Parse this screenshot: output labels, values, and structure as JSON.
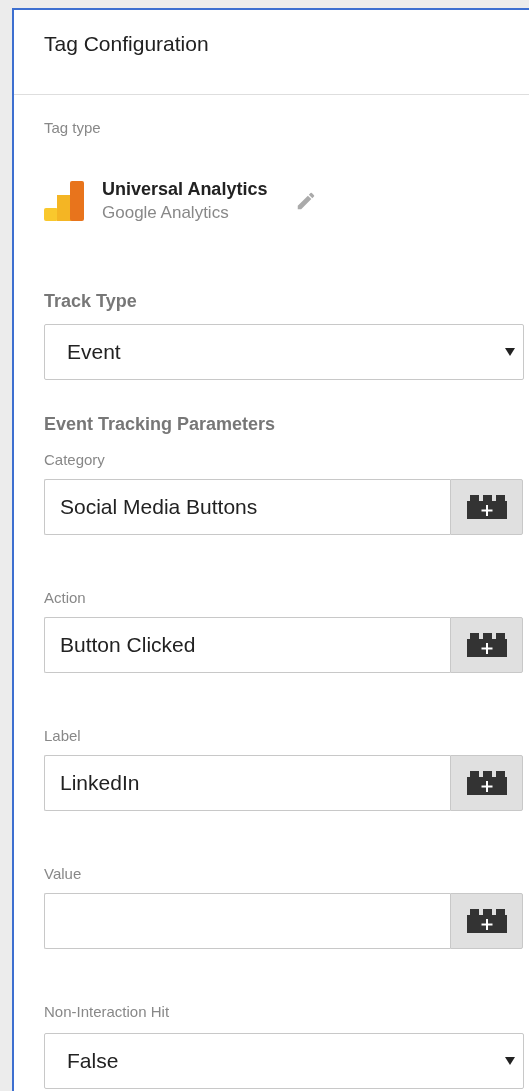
{
  "panel": {
    "title": "Tag Configuration"
  },
  "tag_type": {
    "label": "Tag type",
    "name": "Universal Analytics",
    "vendor": "Google Analytics"
  },
  "track_type": {
    "label": "Track Type",
    "value": "Event"
  },
  "section_title": "Event Tracking Parameters",
  "fields": [
    {
      "kind": "text",
      "label": "Category",
      "value": "Social Media Buttons"
    },
    {
      "kind": "text",
      "label": "Action",
      "value": "Button Clicked"
    },
    {
      "kind": "text",
      "label": "Label",
      "value": "LinkedIn"
    },
    {
      "kind": "text",
      "label": "Value"
    },
    {
      "kind": "select",
      "label": "Non-Interaction Hit",
      "value": "False"
    }
  ]
}
